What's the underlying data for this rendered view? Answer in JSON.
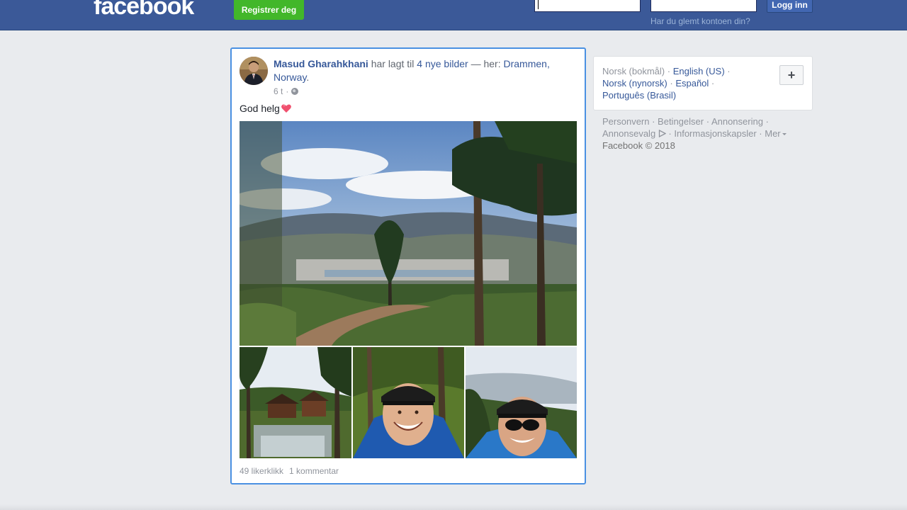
{
  "header": {
    "logo": "facebook",
    "register_label": "Registrer deg",
    "email_placeholder": "",
    "password_placeholder": "",
    "login_label": "Logg inn",
    "forgot_label": "Har du glemt kontoen din?"
  },
  "post": {
    "author": "Masud Gharahkhani",
    "action_text": " har lagt til ",
    "photos_link": "4 nye bilder",
    "location_prefix": " — her: ",
    "location": "Drammen, Norway",
    "location_suffix": ".",
    "time": "6 t",
    "separator": "·",
    "text": "God helg",
    "likes": "49 likerklikk",
    "comments": "1 kommentar"
  },
  "languages": {
    "current": "Norsk (bokmål)",
    "items": [
      "English (US)",
      "Norsk (nynorsk)",
      "Español",
      "Português (Brasil)"
    ],
    "add_label": "+"
  },
  "footer": {
    "links": [
      "Personvern",
      "Betingelser",
      "Annonsering",
      "Annonsevalg",
      "Informasjonskapsler",
      "Mer"
    ],
    "copyright": "Facebook © 2018"
  },
  "colors": {
    "topbar": "#3b5998",
    "register": "#42b72a",
    "link": "#365899",
    "post_border": "#4a90e2"
  }
}
